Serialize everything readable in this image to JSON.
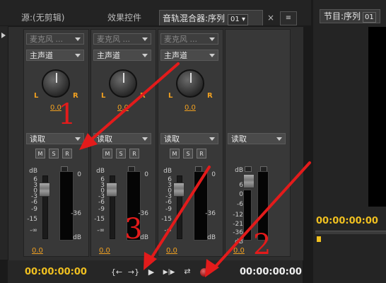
{
  "panels": {
    "tabs": [
      {
        "label": "源:(无剪辑)",
        "active": false
      },
      {
        "label": "效果控件",
        "active": false
      },
      {
        "label": "音轨混合器:序列",
        "selector": "01",
        "active": true
      }
    ],
    "menu_glyph": "≡",
    "menu_arrow": "▾",
    "close_glyph": "×"
  },
  "mixer": {
    "tracks": [
      {
        "input": "麦克风 ...",
        "output": "主声道",
        "pan_value": "0.0",
        "automation": "读取",
        "volume": "0.0",
        "show_fader": true
      },
      {
        "input": "麦克风 ...",
        "output": "主声道",
        "pan_value": "0.0",
        "automation": "读取",
        "volume": "0.0",
        "show_fader": true
      },
      {
        "input": "麦克风 ...",
        "output": "主声道",
        "pan_value": "0.0",
        "automation": "读取",
        "volume": "0.0",
        "show_fader": true
      },
      {
        "input": "",
        "output": "",
        "pan_value": "",
        "automation": "读取",
        "volume": "0.0",
        "show_fader": true
      }
    ],
    "pan_left": "L",
    "pan_right": "R",
    "msr": [
      "M",
      "S",
      "R"
    ],
    "fader_scale": [
      "dB",
      "6",
      "3",
      "0",
      "-3",
      "-6",
      "-9",
      "-15",
      "-∞"
    ],
    "master_scale": [
      "dB",
      "6",
      "0",
      "-6",
      "-12",
      "-21",
      "-36",
      "dB"
    ],
    "meter_scale": [
      "0",
      "-36",
      "dB"
    ]
  },
  "transport": {
    "in_time": "00:00:00:00",
    "out_time": "00:00:00:00",
    "buttons": [
      "{←",
      "→}",
      "▶",
      "▶|▶",
      "⇄"
    ],
    "record_color": "#c0302c"
  },
  "program": {
    "tab_label": "节目:序列",
    "selector": "01",
    "timecode": "00:00:00:00"
  },
  "annotations": {
    "labels": [
      "1",
      "2",
      "3"
    ],
    "color": "#e31b1b"
  }
}
